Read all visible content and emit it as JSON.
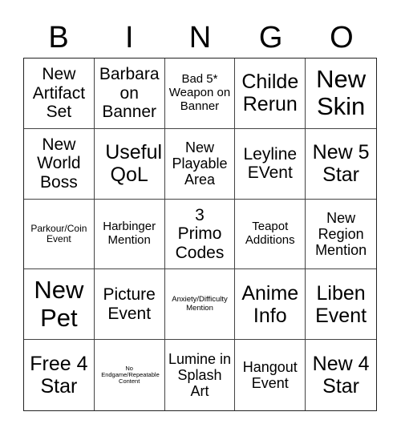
{
  "header": {
    "letters": [
      "B",
      "I",
      "N",
      "G",
      "O"
    ]
  },
  "cells": [
    [
      "New Artifact Set",
      "Barbara on Banner",
      "Bad 5* Weapon on Banner",
      "Childe Rerun",
      "New Skin"
    ],
    [
      "New World Boss",
      "Useful QoL",
      "New Playable Area",
      "Leyline EVent",
      "New 5 Star"
    ],
    [
      "Parkour/Coin Event",
      "Harbinger Mention",
      "3 Primo Codes",
      "Teapot Additions",
      "New Region Mention"
    ],
    [
      "New Pet",
      "Picture Event",
      "Anxiety/Difficulty Mention",
      "Anime Info",
      "Liben Event"
    ],
    [
      "Free 4 Star",
      "No Endgame/Repeatable Content",
      "Lumine in Splash Art",
      "Hangout Event",
      "New 4 Star"
    ]
  ]
}
